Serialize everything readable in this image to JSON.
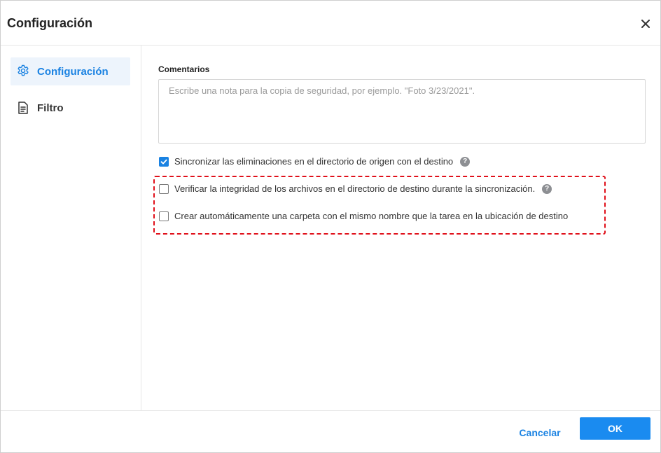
{
  "dialog": {
    "title": "Configuración",
    "close_icon": "close-icon"
  },
  "sidebar": {
    "items": [
      {
        "label": "Configuración",
        "icon": "gear-icon",
        "active": true
      },
      {
        "label": "Filtro",
        "icon": "document-filter-icon",
        "active": false
      }
    ]
  },
  "main": {
    "comments_label": "Comentarios",
    "comments_placeholder": "Escribe una nota para la copia de seguridad, por ejemplo. \"Foto 3/23/2021\".",
    "comments_value": "",
    "options": [
      {
        "label": "Sincronizar las eliminaciones en el directorio de origen con el destino",
        "checked": true,
        "has_help": true
      },
      {
        "label": "Verificar la integridad de los archivos en el directorio de destino durante la sincronización.",
        "checked": false,
        "has_help": true
      },
      {
        "label": "Crear automáticamente una carpeta con el mismo nombre que la tarea en la ubicación de destino",
        "checked": false,
        "has_help": false
      }
    ],
    "help_glyph": "?"
  },
  "footer": {
    "cancel_label": "Cancelar",
    "ok_label": "OK"
  },
  "colors": {
    "accent": "#1a82e2",
    "ok_button": "#1a8bf0",
    "highlight_border": "#e0101a",
    "active_nav_bg": "#edf4fc"
  }
}
